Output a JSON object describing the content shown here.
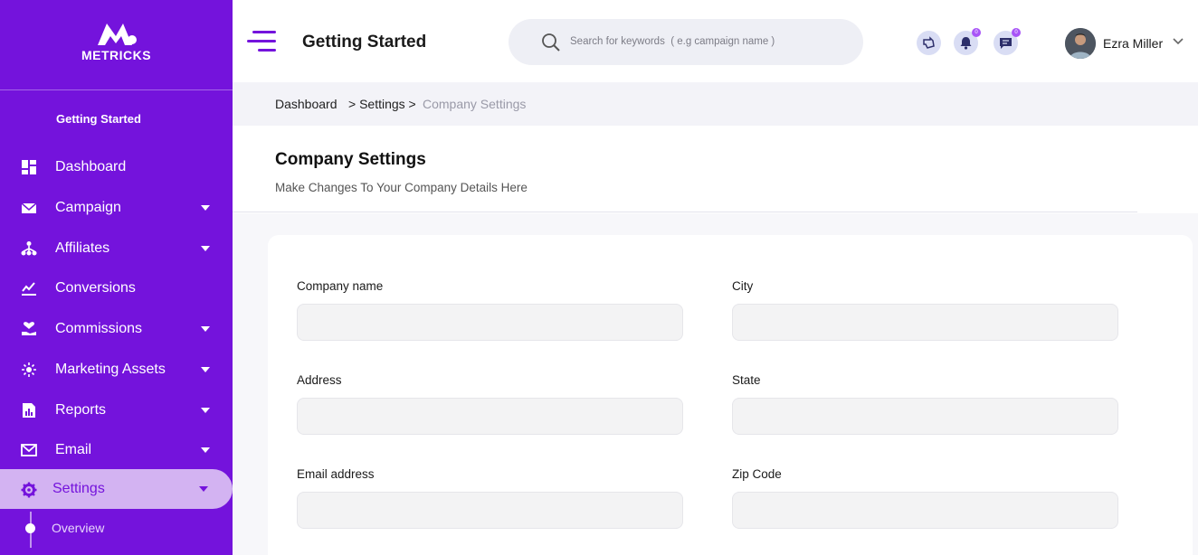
{
  "brand": {
    "logo_text": "METRICKS"
  },
  "sidebar": {
    "section_title": "Getting Started",
    "items": [
      {
        "label": "Dashboard",
        "icon": "dashboard-grid-icon",
        "has_caret": false
      },
      {
        "label": "Campaign",
        "icon": "envelope-icon",
        "has_caret": true
      },
      {
        "label": "Affiliates",
        "icon": "affiliates-tree-icon",
        "has_caret": true
      },
      {
        "label": "Conversions",
        "icon": "chart-line-icon",
        "has_caret": false
      },
      {
        "label": "Commissions",
        "icon": "heart-hand-icon",
        "has_caret": true
      },
      {
        "label": "Marketing Assets",
        "icon": "sparkle-icon",
        "has_caret": true
      },
      {
        "label": "Reports",
        "icon": "report-doc-icon",
        "has_caret": true
      },
      {
        "label": "Email",
        "icon": "mail-icon",
        "has_caret": true
      },
      {
        "label": "Settings",
        "icon": "gear-icon",
        "has_caret": true,
        "active": true
      }
    ],
    "sub_items": [
      {
        "label": "Overview"
      }
    ]
  },
  "topbar": {
    "title": "Getting Started",
    "search_placeholder": "Search for keywords  ( e.g campaign name )",
    "notification_count": "0",
    "message_count": "0",
    "user_name": "Ezra Miller"
  },
  "breadcrumb": {
    "items": [
      "Dashboard",
      "> Settings >",
      "Company Settings"
    ]
  },
  "header": {
    "title": "Company Settings",
    "subtitle": "Make Changes To Your Company Details Here"
  },
  "form": {
    "fields": [
      {
        "label": "Company name",
        "value": ""
      },
      {
        "label": "City",
        "value": ""
      },
      {
        "label": "Address",
        "value": ""
      },
      {
        "label": "State",
        "value": ""
      },
      {
        "label": "Email address",
        "value": ""
      },
      {
        "label": "Zip Code",
        "value": ""
      }
    ]
  },
  "colors": {
    "primary": "#7413dc",
    "active_bg": "#d3b3f2",
    "search_bg": "#eeeff5",
    "input_bg": "#f3f3f4"
  }
}
